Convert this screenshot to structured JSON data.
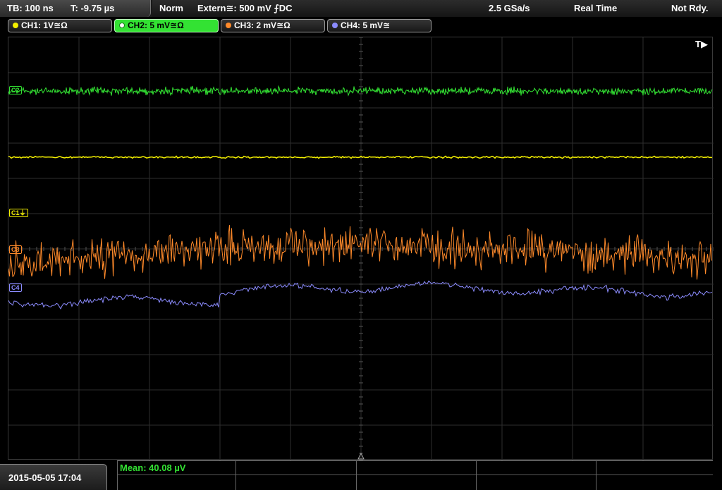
{
  "header": {
    "timebase": "TB: 100 ns",
    "trigger_time": "T: -9.75 µs",
    "mode": "Norm",
    "trigger_source": "Extern≅: 500 mV ⨍DC",
    "sample_rate": "2.5 GSa/s",
    "acq_mode": "Real Time",
    "status": "Not Rdy."
  },
  "channels": [
    {
      "label": "CH1: 1V≅Ω",
      "color": "#f4f000"
    },
    {
      "label": "CH2: 5 mV≅Ω",
      "color": "#33e233"
    },
    {
      "label": "CH3: 2 mV≅Ω",
      "color": "#ff8a2a"
    },
    {
      "label": "CH4: 5 mV≅",
      "color": "#8c8cff"
    }
  ],
  "screen": {
    "trigger_marker": "T▶",
    "level_markers": [
      {
        "label": "C1⏚",
        "color": "#f4f000"
      },
      {
        "label": "C3",
        "color": "#ff8a2a"
      },
      {
        "label": "C4",
        "color": "#8c8cff"
      },
      {
        "label": "C2",
        "color": "#33e233"
      }
    ]
  },
  "footer": {
    "datetime": "2015-05-05 17:04",
    "measurement": "Mean: 40.08 µV"
  }
}
